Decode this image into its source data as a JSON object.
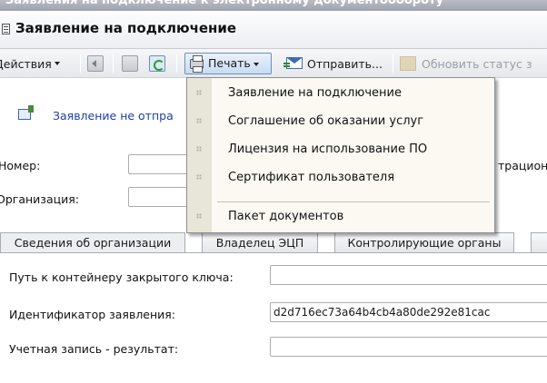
{
  "window": {
    "title": "Заявления на подключение к электронному документообороту"
  },
  "form": {
    "title": "Заявление на подключение"
  },
  "toolbar": {
    "actions_label": "Действия",
    "print_label": "Печать",
    "send_label": "Отправить...",
    "update_status_label": "Обновить статус з"
  },
  "print_menu": {
    "items": [
      "Заявление  на подключение",
      "Соглашение об оказании услуг",
      "Лицензия на использование ПО",
      "Сертификат пользователя",
      "Пакет документов"
    ]
  },
  "info": {
    "text": "Заявление не отпра"
  },
  "fields": {
    "number_label": "Номер:",
    "registration_label_partial": "трацион",
    "organization_label": "Организация:"
  },
  "tabs": [
    {
      "label": "Сведения об организации",
      "active": true
    },
    {
      "label": "Владелец ЭЦП",
      "active": false
    },
    {
      "label": "Контролирующие органы",
      "active": false
    }
  ],
  "details": {
    "key_path_label": "Путь к контейнеру закрытого ключа:",
    "key_path_value": "",
    "request_id_label": "Идентификатор заявления:",
    "request_id_value": "d2d716ec73a64b4cb4a80de292e81cac",
    "account_label": "Учетная запись - результат:",
    "account_value": ""
  },
  "colors": {
    "info_text": "#1c3fa8",
    "menu_background": "#fbf9f2",
    "menu_gutter": "#e8e6d8"
  }
}
